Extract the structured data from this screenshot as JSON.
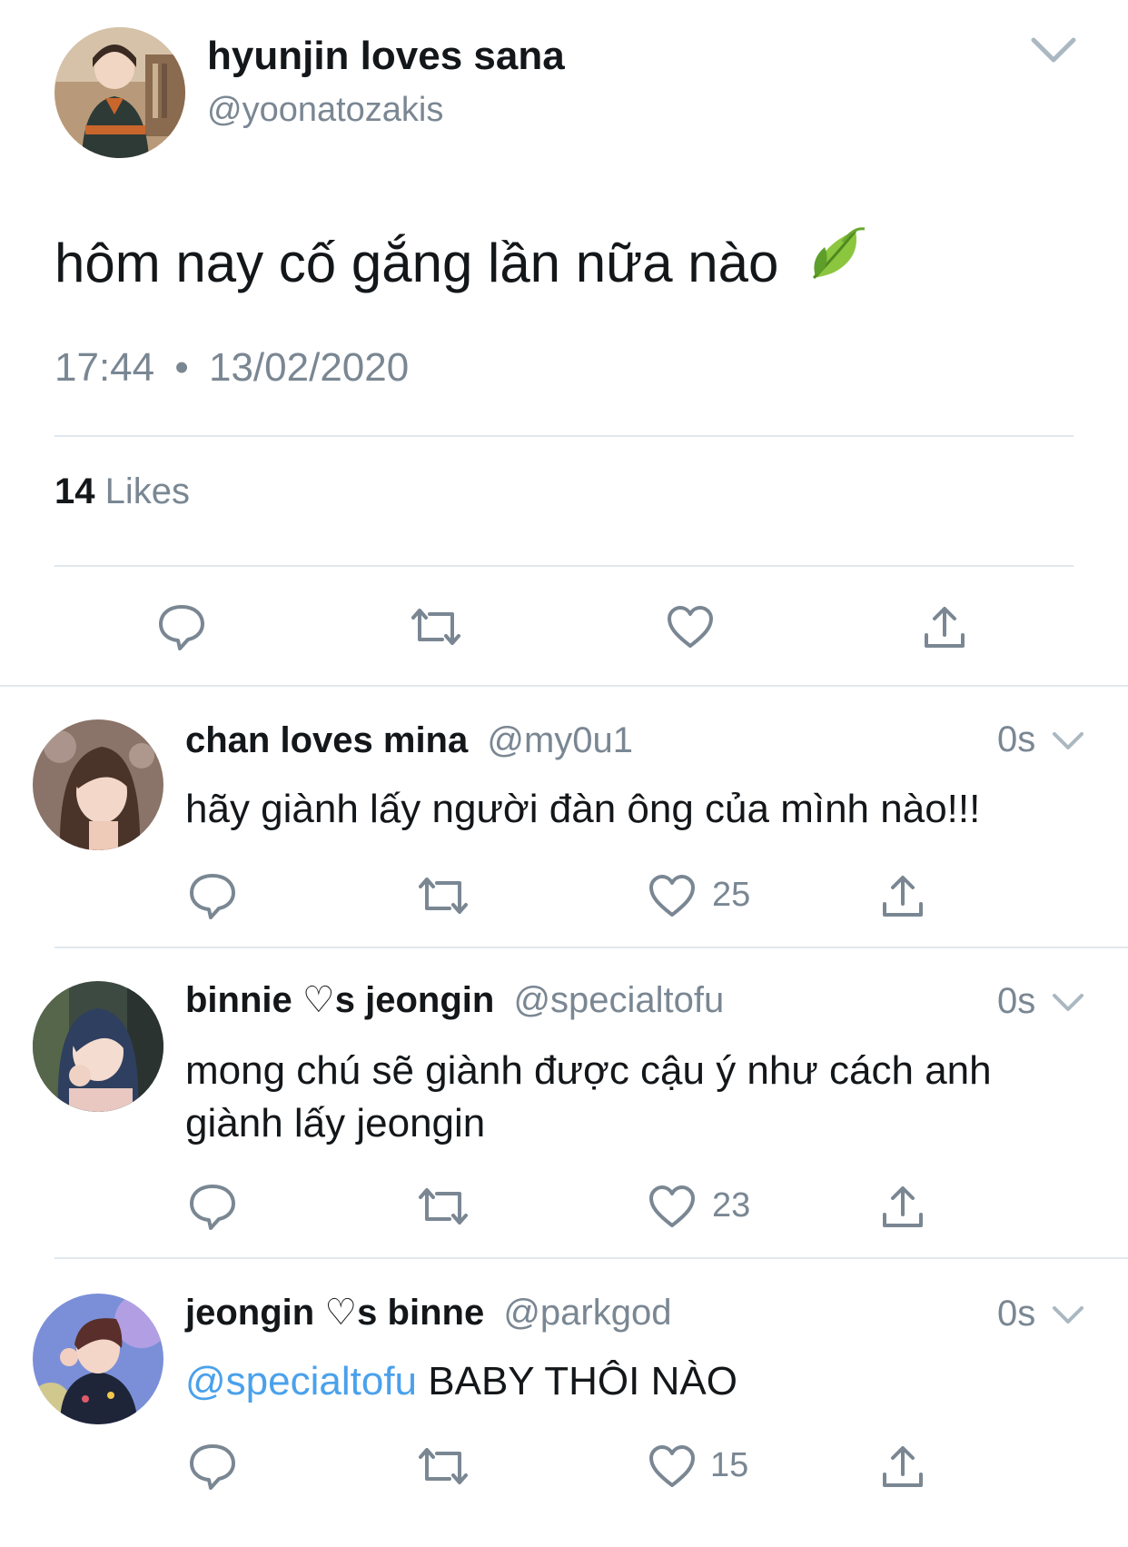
{
  "tweet": {
    "display_name": "hyunjin loves sana",
    "handle": "@yoonatozakis",
    "text": "hôm nay cố gắng lần nữa nào",
    "emoji_icon": "leaf-icon",
    "time": "17:44",
    "separator": "•",
    "date": "13/02/2020",
    "likes_count": "14",
    "likes_label": "Likes"
  },
  "replies": [
    {
      "display_name": "chan loves mina",
      "handle": "@my0u1",
      "time": "0s",
      "text": "hãy giành lấy người đàn ông của mình nào!!!",
      "like_count": "25"
    },
    {
      "display_name": "binnie ♡s jeongin",
      "handle": "@specialtofu",
      "time": "0s",
      "text_line1": "mong chú sẽ giành được cậu ý như cách anh",
      "text_line2": "giành lấy jeongin",
      "like_count": "23"
    },
    {
      "display_name": "jeongin ♡s binne",
      "handle": "@parkgod",
      "time": "0s",
      "mention": "@specialtofu",
      "text": " BABY THÔI NÀO",
      "like_count": "15"
    }
  ],
  "colors": {
    "text": "#14171a",
    "secondary": "#7a8793",
    "divider": "#e1e8ed",
    "link": "#4aa1eb"
  },
  "icons": [
    "chevron-down-icon",
    "reply-icon",
    "retweet-icon",
    "heart-icon",
    "share-icon",
    "leaf-icon"
  ]
}
